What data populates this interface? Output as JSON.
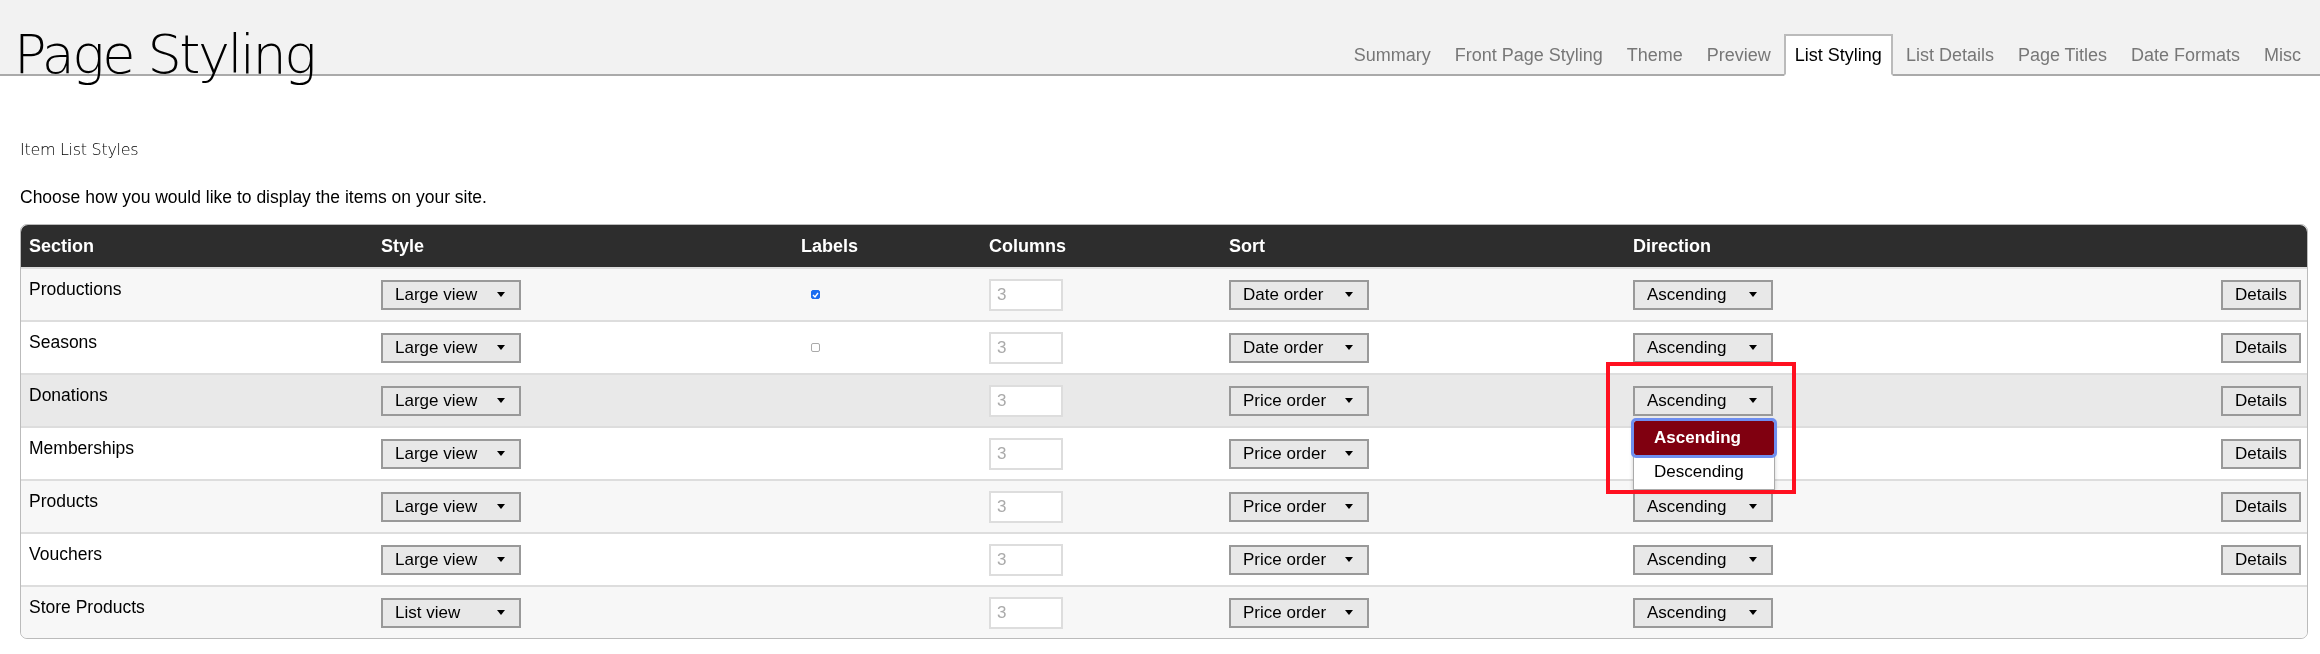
{
  "page_title": "Page Styling",
  "tabs": [
    {
      "label": "Summary",
      "selected": false
    },
    {
      "label": "Front Page Styling",
      "selected": false
    },
    {
      "label": "Theme",
      "selected": false
    },
    {
      "label": "Preview",
      "selected": false
    },
    {
      "label": "List Styling",
      "selected": true
    },
    {
      "label": "List Details",
      "selected": false
    },
    {
      "label": "Page Titles",
      "selected": false
    },
    {
      "label": "Date Formats",
      "selected": false
    },
    {
      "label": "Misc",
      "selected": false
    }
  ],
  "section_title": "Item List Styles",
  "intro": "Choose how you would like to display the items on your site.",
  "table": {
    "columns": [
      "Section",
      "Style",
      "Labels",
      "Columns",
      "Sort",
      "Direction"
    ],
    "rows": [
      {
        "section": "Productions",
        "style": "Large view",
        "labels": {
          "checked": true
        },
        "columns": "3",
        "sort": "Date order",
        "direction": "Ascending",
        "details": "Details",
        "highlighted": false
      },
      {
        "section": "Seasons",
        "style": "Large view",
        "labels": {
          "checked": false
        },
        "columns": "3",
        "sort": "Date order",
        "direction": "Ascending",
        "details": "Details",
        "highlighted": false
      },
      {
        "section": "Donations",
        "style": "Large view",
        "columns": "3",
        "sort": "Price order",
        "direction": "Ascending",
        "details": "Details",
        "highlighted": true,
        "open_menu": {
          "options": [
            {
              "label": "Ascending",
              "selected": true
            },
            {
              "label": "Descending",
              "selected": false
            }
          ]
        }
      },
      {
        "section": "Memberships",
        "style": "Large view",
        "columns": "3",
        "sort": "Price order",
        "details": "Details",
        "highlighted": false
      },
      {
        "section": "Products",
        "style": "Large view",
        "columns": "3",
        "sort": "Price order",
        "direction": "Ascending",
        "details": "Details",
        "highlighted": false
      },
      {
        "section": "Vouchers",
        "style": "Large view",
        "columns": "3",
        "sort": "Price order",
        "direction": "Ascending",
        "details": "Details",
        "highlighted": false
      },
      {
        "section": "Store Products",
        "style": "List view",
        "columns": "3",
        "sort": "Price order",
        "direction": "Ascending",
        "highlighted": false
      }
    ]
  }
}
